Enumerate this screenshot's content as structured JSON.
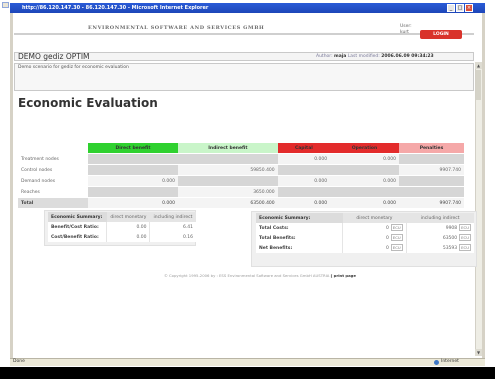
{
  "window": {
    "title": "http://86.120.147.30 - 86.120.147.30 - Microsoft Internet Explorer",
    "minimize": "_",
    "maximize": "□",
    "close": "×"
  },
  "header": {
    "brand": "ENVIRONMENTAL SOFTWARE AND SERVICES GMBH",
    "user_label": "User:",
    "user_name": "kurt",
    "logout_label": "LOGIN"
  },
  "project": {
    "name": "DEMO gediz OPTIM",
    "author_label": "Author:",
    "author": "maja",
    "modified_label": "Last modified:",
    "modified": "2006.06.09 09:34:23",
    "description": "Demo scenario for gediz for economic evaluation"
  },
  "page_title": "Economic Evaluation",
  "colors": {
    "direct_benefit": "#2fd12f",
    "indirect_benefit": "#c9f5c9",
    "capital": "#e32b2b",
    "operation": "#e32b2b",
    "penalties": "#f5a8a8"
  },
  "main_table": {
    "headers": [
      "",
      "Direct benefit",
      "Indirect benefit",
      "Capital",
      "Operation",
      "Penalties"
    ],
    "rows": [
      {
        "label": "Treatment nodes",
        "cells": [
          "",
          "",
          "0.000",
          "0.000",
          ""
        ]
      },
      {
        "label": "Control nodes",
        "cells": [
          "",
          "59850.400",
          "",
          "",
          "9907.740"
        ]
      },
      {
        "label": "Demand nodes",
        "cells": [
          "0.000",
          "",
          "0.000",
          "0.000",
          ""
        ]
      },
      {
        "label": "Reaches",
        "cells": [
          "",
          "3650.000",
          "",
          "",
          ""
        ]
      },
      {
        "label": "Total",
        "cells": [
          "0.000",
          "63500.400",
          "0.000",
          "0.000",
          "9907.740"
        ]
      }
    ]
  },
  "summary1": {
    "header": "Economic Summary:",
    "col1": "direct monetary",
    "col2": "including indirect",
    "rows": [
      {
        "label": "Benefit/Cost Ratio:",
        "v1": "0.00",
        "v2": "6.41"
      },
      {
        "label": "Cost/Benefit Ratio:",
        "v1": "0.00",
        "v2": "0.16"
      }
    ]
  },
  "summary2": {
    "header": "Economic Summary:",
    "col1": "direct monetary",
    "col2": "including indirect",
    "unit": "ECU",
    "rows": [
      {
        "label": "Total Costs:",
        "v1": "0",
        "v2": "9908"
      },
      {
        "label": "Total Benefits:",
        "v1": "0",
        "v2": "63500"
      },
      {
        "label": "Net Benefits:",
        "v1": "0",
        "v2": "53593"
      }
    ]
  },
  "footer": {
    "text": "© Copyright 1995-2006 by : ESS Environmental Software and Services GmbH AUSTRIA",
    "link": "[ print page"
  },
  "statusbar": {
    "left": "Done",
    "zone": "Internet"
  }
}
